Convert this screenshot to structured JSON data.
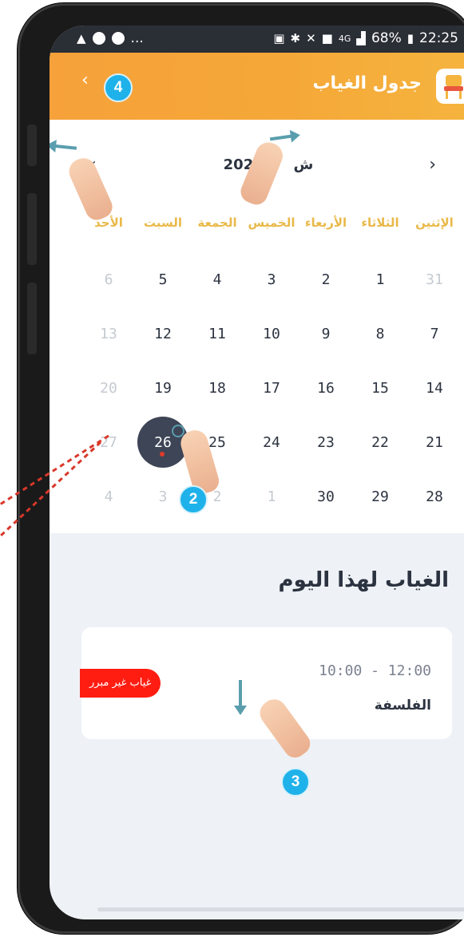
{
  "status_bar": {
    "left_icons": [
      "warning-icon",
      "app-icon",
      "app-icon",
      "more-icon"
    ],
    "more": "...",
    "network": "4G",
    "battery": "68%",
    "time": "22:25"
  },
  "app_bar": {
    "title": "جدول الغياب",
    "back_glyph": "‹"
  },
  "calendar": {
    "month_label": "202",
    "month_suffix": "ش",
    "prev_glyph": "‹",
    "next_glyph": "›",
    "weekdays": [
      "الإثنين",
      "الثلاثاء",
      "الأربعاء",
      "الخميس",
      "الجمعة",
      "السبت",
      "الأحد"
    ],
    "weeks": [
      [
        "31",
        "1",
        "2",
        "3",
        "4",
        "5",
        "6"
      ],
      [
        "7",
        "8",
        "9",
        "10",
        "11",
        "12",
        "13"
      ],
      [
        "14",
        "15",
        "16",
        "17",
        "18",
        "19",
        "20"
      ],
      [
        "21",
        "22",
        "23",
        "24",
        "25",
        "26",
        "27"
      ],
      [
        "28",
        "29",
        "30",
        "1",
        "2",
        "3",
        "4"
      ]
    ],
    "selected_day": "26"
  },
  "absence": {
    "section_title": "الغياب لهذا اليوم",
    "items": [
      {
        "time": "10:00 - 12:00",
        "subject": "الفلسفة",
        "badge": "غياب غير مبرر"
      }
    ]
  },
  "tutorial_markers": [
    "4",
    "2",
    "3"
  ],
  "colors": {
    "accent": "#F5A838",
    "selected_day": "#3D4556",
    "weekday_label": "#E9B949",
    "badge": "#FF1D12",
    "marker": "#1FB2EA"
  }
}
